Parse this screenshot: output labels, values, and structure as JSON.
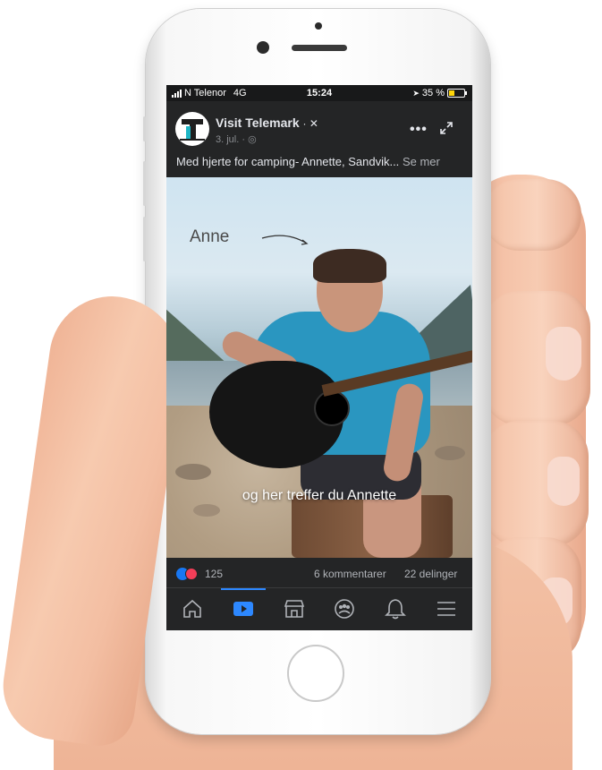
{
  "status_bar": {
    "carrier": "N Telenor",
    "network": "4G",
    "time": "15:24",
    "battery": "35 %"
  },
  "post": {
    "page_name": "Visit Telemark",
    "date": "3. jul.",
    "caption": "Med hjerte for camping- Annette, Sandvik...",
    "see_more": "Se mer"
  },
  "video": {
    "overlay_name": "Anne",
    "subtitle": "og her treffer du Annette"
  },
  "engagement": {
    "reaction_count": "125",
    "comments": "6 kommentarer",
    "shares": "22 delinger"
  },
  "tabs": [
    {
      "name": "home",
      "icon": "home-icon",
      "active": false
    },
    {
      "name": "watch",
      "icon": "video-icon",
      "active": true
    },
    {
      "name": "marketplace",
      "icon": "shop-icon",
      "active": false
    },
    {
      "name": "groups",
      "icon": "groups-icon",
      "active": false
    },
    {
      "name": "notifications",
      "icon": "bell-icon",
      "active": false
    },
    {
      "name": "menu",
      "icon": "menu-icon",
      "active": false
    }
  ],
  "colors": {
    "background": "#242526",
    "accent": "#2d88ff",
    "like": "#1877f2",
    "love": "#f33e58"
  }
}
